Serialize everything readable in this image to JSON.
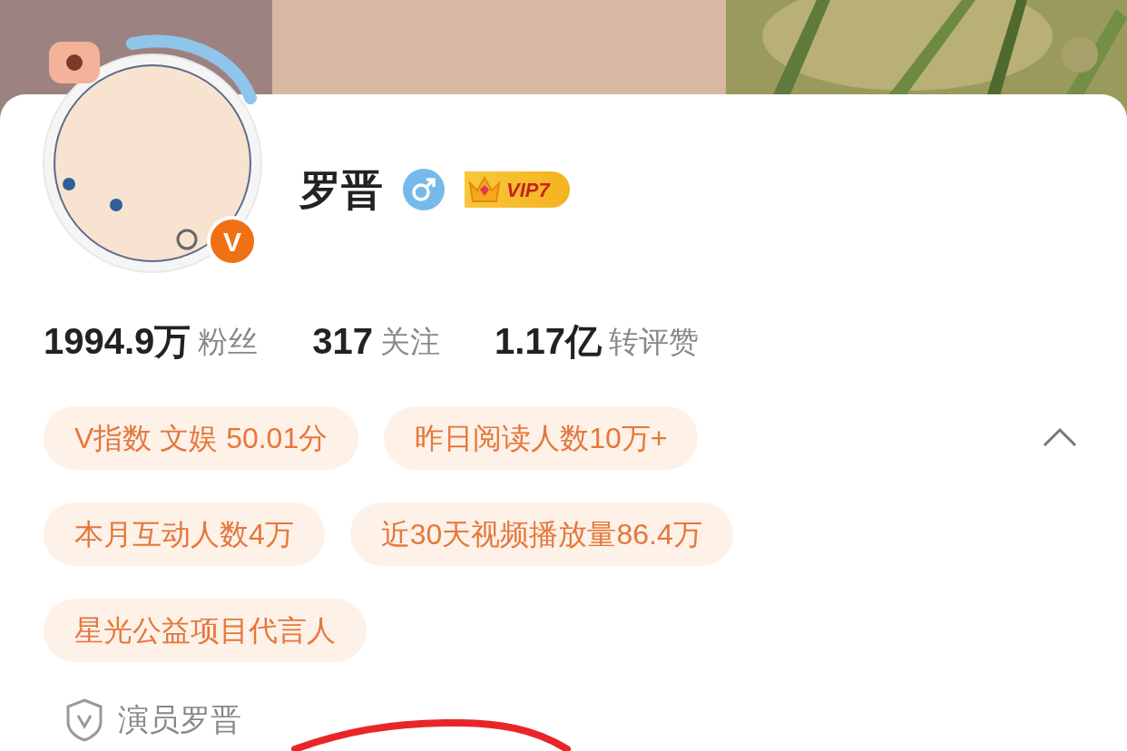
{
  "profile": {
    "name": "罗晋",
    "gender_icon": {
      "kind": "male"
    },
    "vip": "VIP7",
    "verified_mark": "V"
  },
  "stats": [
    {
      "number": "1994.9万",
      "caption": "粉丝"
    },
    {
      "number": "317",
      "caption": "关注"
    },
    {
      "number": "1.17亿",
      "caption": "转评赞"
    }
  ],
  "tags": {
    "expanded": true,
    "items": [
      {
        "text": "V指数 文娱 50.01分"
      },
      {
        "text": "昨日阅读人数10万+"
      },
      {
        "text": "本月互动人数4万"
      },
      {
        "text": "近30天视频播放量86.4万"
      },
      {
        "text": "星光公益项目代言人"
      }
    ]
  },
  "certification": "演员罗晋"
}
